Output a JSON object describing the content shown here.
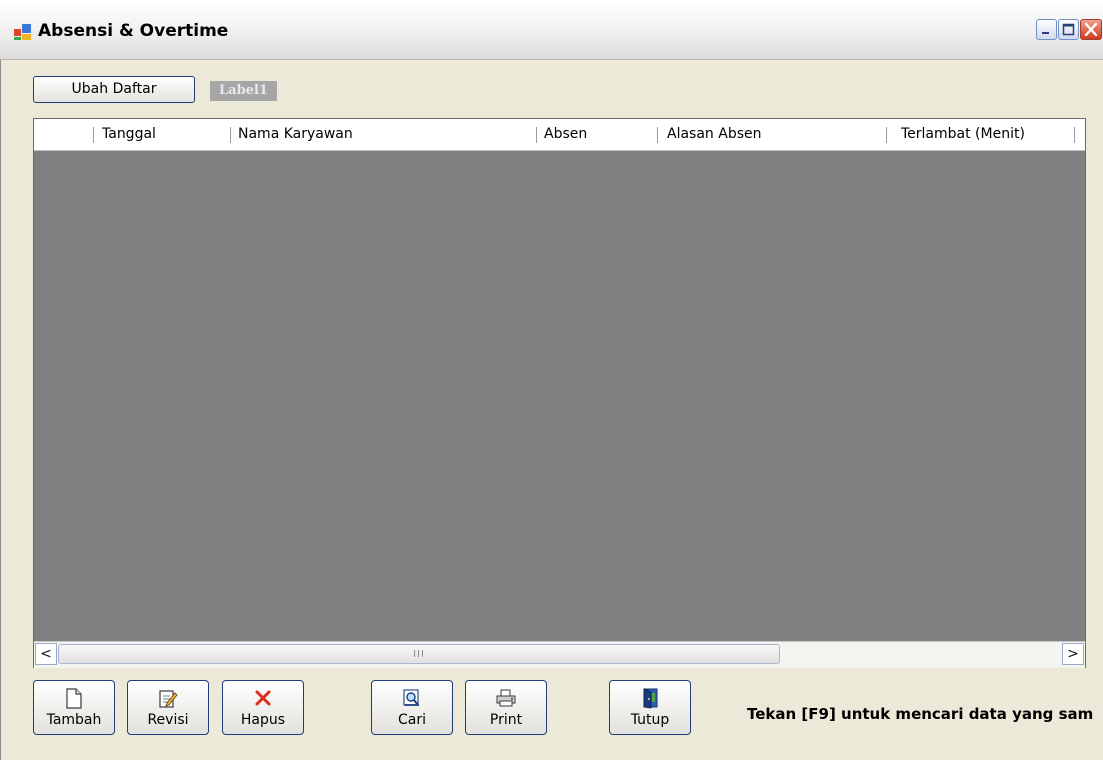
{
  "window": {
    "title": "Absensi & Overtime",
    "app_icon": "form-icon",
    "caption_buttons": [
      "minimize-icon",
      "maximize-icon",
      "close-icon"
    ]
  },
  "toolbar_top": {
    "ubah_daftar_label": "Ubah Daftar",
    "label1_text": "Label1"
  },
  "grid": {
    "columns": [
      "",
      "Tanggal",
      "Nama Karyawan",
      "Absen",
      "Alasan Absen",
      "Terlambat (Menit)",
      ""
    ],
    "rows": [],
    "scroll_left_glyph": "<",
    "scroll_right_glyph": ">",
    "scroll_thumb_glyph": "III"
  },
  "buttons": {
    "tambah": {
      "label": "Tambah",
      "icon": "new-document-icon"
    },
    "revisi": {
      "label": "Revisi",
      "icon": "edit-icon"
    },
    "hapus": {
      "label": "Hapus",
      "icon": "delete-icon"
    },
    "cari": {
      "label": "Cari",
      "icon": "search-icon"
    },
    "print": {
      "label": "Print",
      "icon": "printer-icon"
    },
    "tutup": {
      "label": "Tutup",
      "icon": "exit-door-icon"
    }
  },
  "hint_text": "Tekan [F9] untuk mencari data yang sam",
  "colors": {
    "window_bg": "#ECE9D8",
    "grid_bg": "#808080",
    "button_border": "#1f3e7a",
    "close_button": "#cf3b1e"
  }
}
